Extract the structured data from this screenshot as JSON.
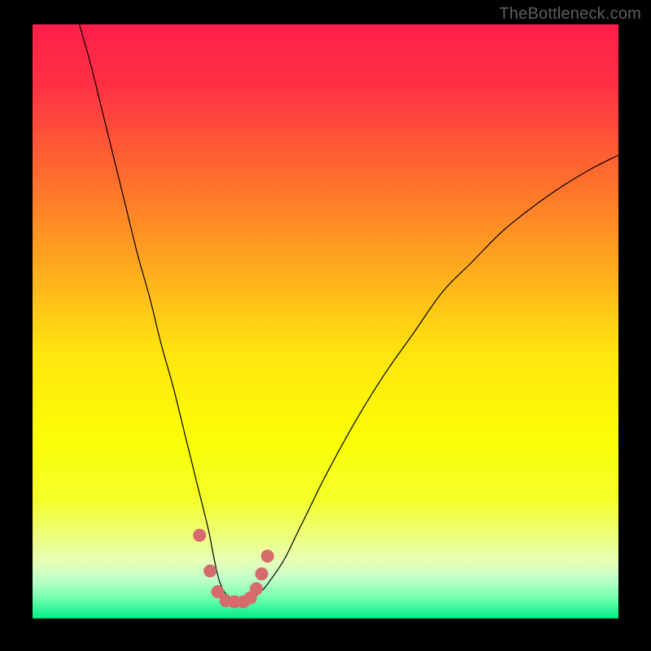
{
  "watermark": {
    "text": "TheBottleneck.com"
  },
  "chart_data": {
    "type": "line",
    "title": "",
    "xlabel": "",
    "ylabel": "",
    "xlim": [
      0,
      100
    ],
    "ylim": [
      0,
      100
    ],
    "grid": false,
    "legend": false,
    "background_gradient": {
      "stops": [
        {
          "offset": 0.0,
          "color": "#ff1f4b"
        },
        {
          "offset": 0.1,
          "color": "#ff3044"
        },
        {
          "offset": 0.25,
          "color": "#ff6a2e"
        },
        {
          "offset": 0.4,
          "color": "#ffa61f"
        },
        {
          "offset": 0.55,
          "color": "#ffe40f"
        },
        {
          "offset": 0.7,
          "color": "#fbff05"
        },
        {
          "offset": 0.8,
          "color": "#f4ff2a"
        },
        {
          "offset": 0.86,
          "color": "#eeff7a"
        },
        {
          "offset": 0.905,
          "color": "#e6ffb9"
        },
        {
          "offset": 0.935,
          "color": "#bfffc7"
        },
        {
          "offset": 0.965,
          "color": "#74ffb0"
        },
        {
          "offset": 1.0,
          "color": "#00e e86"
        }
      ],
      "_note": "offset is fraction from top (y=100) to bottom (y=0)"
    },
    "series": [
      {
        "name": "bottleneck-curve",
        "color": "#000000",
        "stroke_width": 1.2,
        "x": [
          8,
          10,
          12,
          14,
          16,
          18,
          20,
          22,
          24,
          26,
          28,
          30,
          31,
          32,
          33.5,
          35,
          37,
          39,
          41,
          43,
          45,
          47,
          50,
          55,
          60,
          65,
          70,
          75,
          80,
          85,
          90,
          95,
          100
        ],
        "y": [
          100,
          93,
          85,
          77,
          69,
          61,
          54,
          46,
          39,
          31,
          23,
          15,
          10,
          6,
          3.5,
          3,
          3.2,
          4.5,
          7,
          10,
          14,
          18,
          24,
          33,
          41,
          48,
          55,
          60,
          65,
          69,
          72.5,
          75.5,
          78
        ]
      },
      {
        "name": "highlight-dots",
        "type": "scatter",
        "color": "#d66b6b",
        "radius": 8,
        "x": [
          28.5,
          30.3,
          31.6,
          33.0,
          34.5,
          36.0,
          37.2,
          38.2,
          39.1,
          40.1
        ],
        "y": [
          14.0,
          8.0,
          4.5,
          3.0,
          2.8,
          2.8,
          3.5,
          5.0,
          7.5,
          10.5
        ]
      }
    ]
  }
}
